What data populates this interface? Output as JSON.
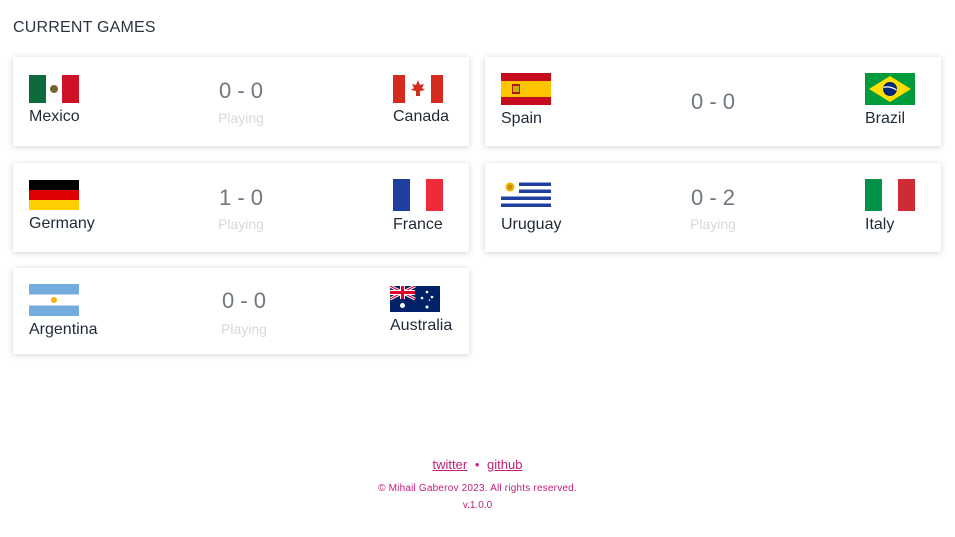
{
  "page_title": "CURRENT GAMES",
  "games": [
    {
      "home": "Mexico",
      "away": "Canada",
      "score": "0 - 0",
      "status": "Playing"
    },
    {
      "home": "Spain",
      "away": "Brazil",
      "score": "0 - 0",
      "status": ""
    },
    {
      "home": "Germany",
      "away": "France",
      "score": "1 - 0",
      "status": "Playing"
    },
    {
      "home": "Uruguay",
      "away": "Italy",
      "score": "0 - 2",
      "status": "Playing"
    },
    {
      "home": "Argentina",
      "away": "Australia",
      "score": "0 - 0",
      "status": "Playing"
    }
  ],
  "footer": {
    "twitter": "twitter",
    "separator": "•",
    "github": "github",
    "copyright": "© Mihail Gaberov 2023. All rights reserved.",
    "version": "v.1.0.0"
  },
  "colors": {
    "accent": "#c2207a",
    "score": "#6f7780",
    "status": "#d6d9dd"
  }
}
